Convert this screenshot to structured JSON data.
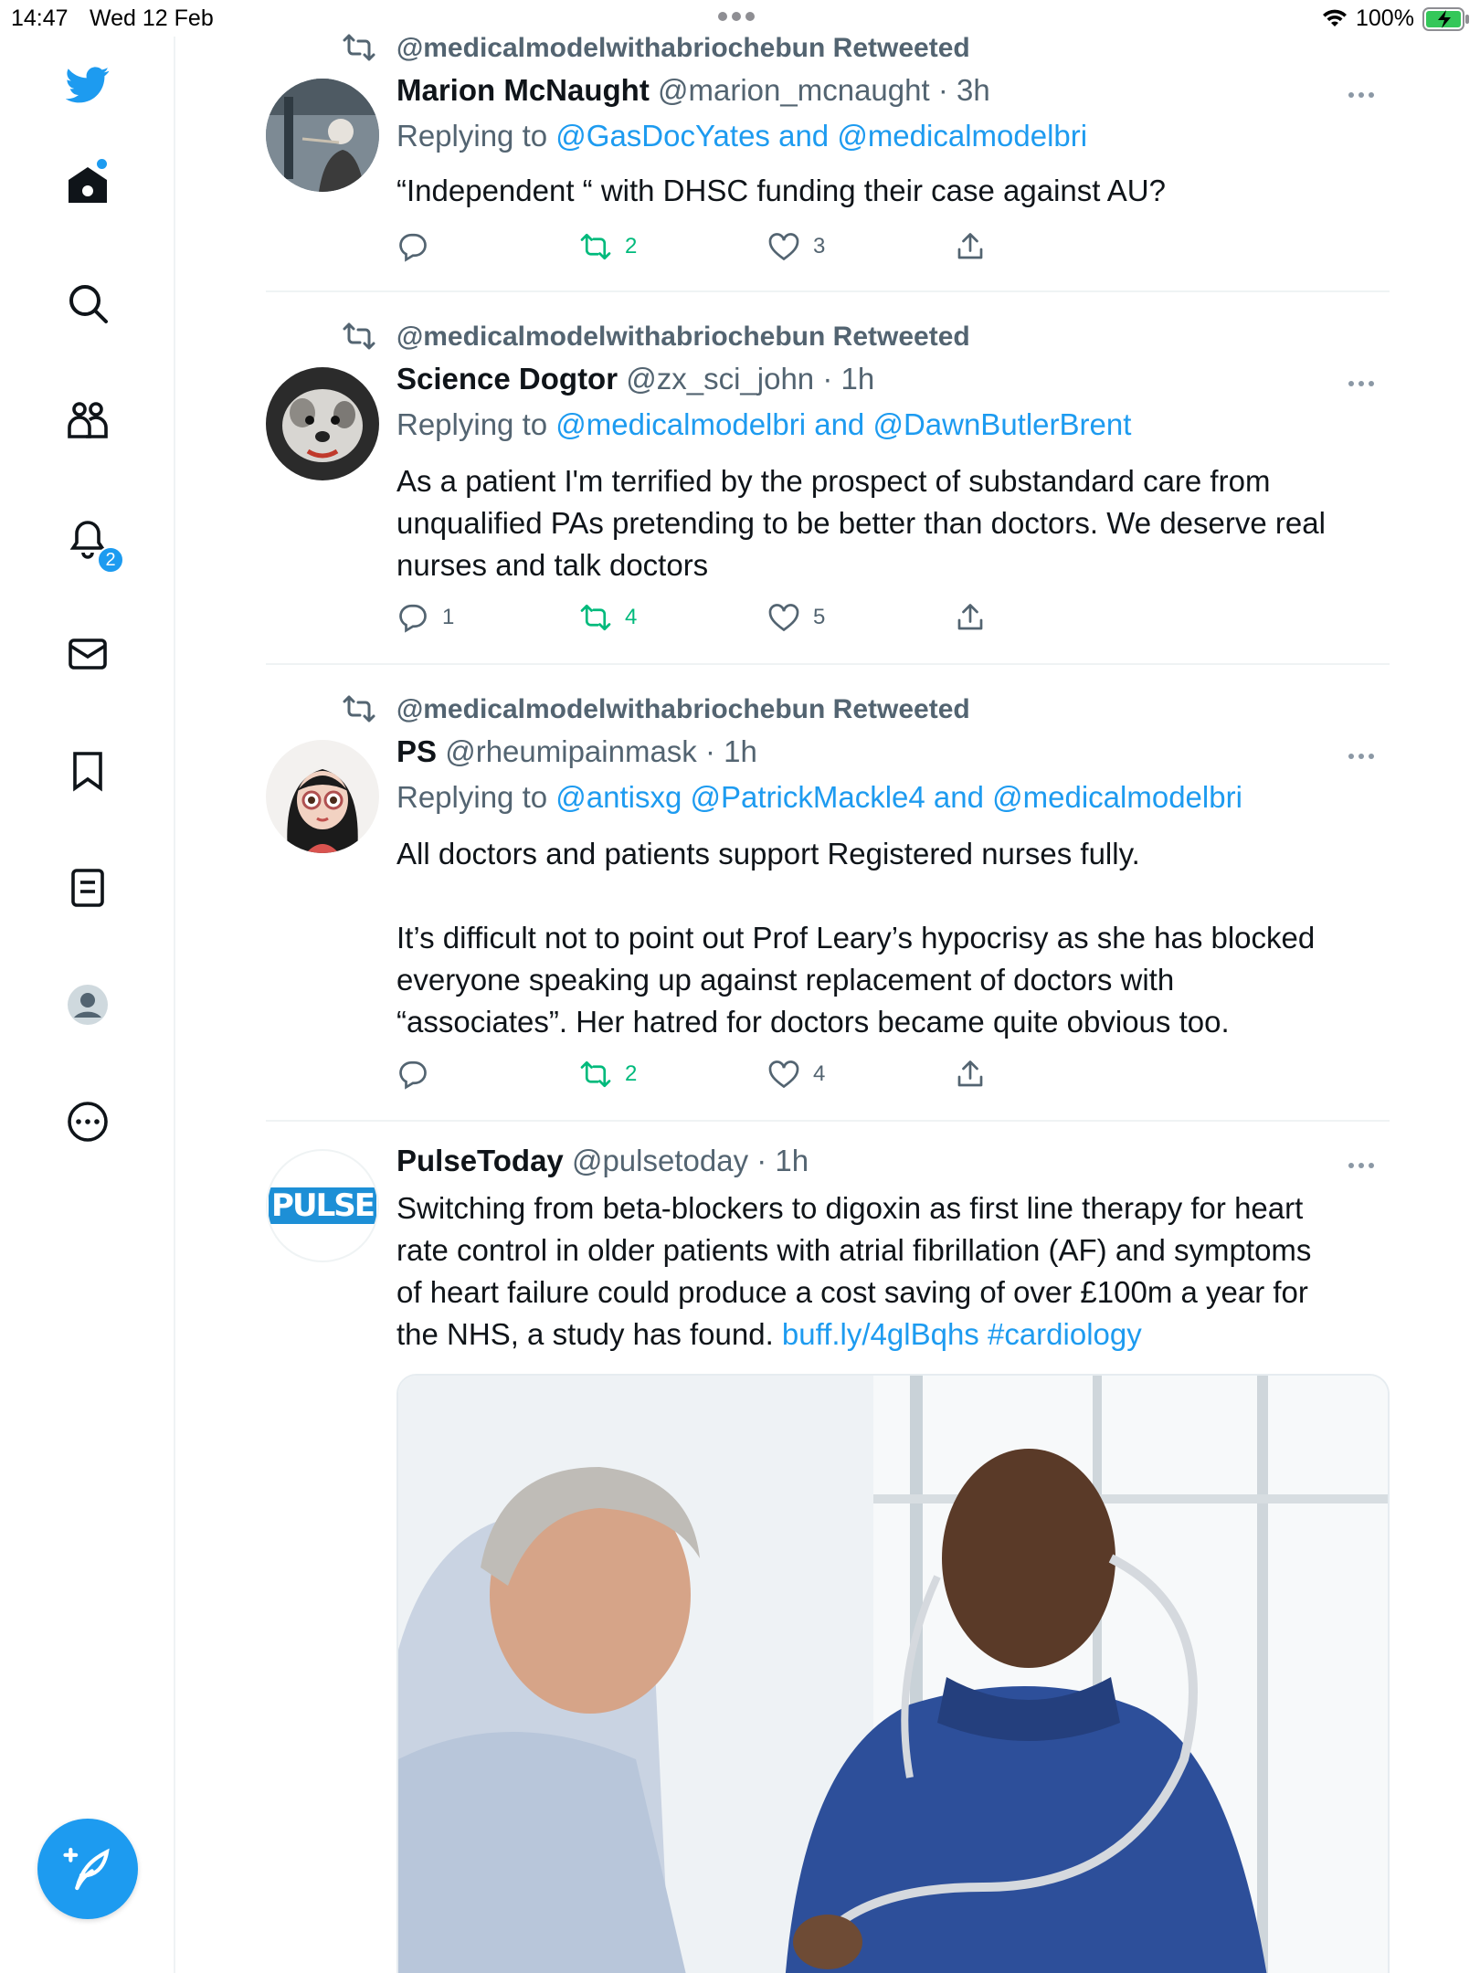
{
  "status_bar": {
    "time": "14:47",
    "date": "Wed 12 Feb",
    "battery": "100%"
  },
  "sidebar": {
    "items": [
      "twitter-logo",
      "home",
      "explore",
      "communities",
      "notifications",
      "messages",
      "bookmarks",
      "lists",
      "profile",
      "more"
    ],
    "notifications_badge": "2"
  },
  "colors": {
    "accent": "#1d9bf0",
    "retweet_green": "#00ba7c",
    "secondary_text": "#536471"
  },
  "tweets": [
    {
      "retweeted_by": "@medicalmodelwithabriochebun Retweeted",
      "name": "Marion McNaught",
      "handle": "@marion_mcnaught",
      "sep": "·",
      "time": "3h",
      "replying_prefix": "Replying to",
      "replying_to": "@GasDocYates and @medicalmodelbri",
      "text": "“Independent “ with DHSC funding their case against AU?",
      "replies": "",
      "retweets": "2",
      "likes": "3"
    },
    {
      "retweeted_by": "@medicalmodelwithabriochebun Retweeted",
      "name": "Science Dogtor",
      "handle": "@zx_sci_john",
      "sep": "·",
      "time": "1h",
      "replying_prefix": "Replying to",
      "replying_to": "@medicalmodelbri and @DawnButlerBrent",
      "text_lines": [
        "As a patient I'm terrified by the prospect of substandard care from",
        "unqualified PAs pretending to be better than doctors. We deserve real",
        "nurses and talk doctors"
      ],
      "replies": "1",
      "retweets": "4",
      "likes": "5"
    },
    {
      "retweeted_by": "@medicalmodelwithabriochebun Retweeted",
      "name": "PS",
      "handle": "@rheumipainmask",
      "sep": "·",
      "time": "1h",
      "replying_prefix": "Replying to",
      "replying_to": "@antisxg @PatrickMackle4 and @medicalmodelbri",
      "text_lines": [
        "All doctors and patients support Registered nurses fully.",
        "",
        "It’s difficult not to point out Prof Leary’s hypocrisy as she has blocked",
        "everyone speaking up against replacement of doctors with",
        "“associates”. Her hatred for doctors became quite obvious too."
      ],
      "replies": "",
      "retweets": "2",
      "likes": "4"
    },
    {
      "name": "PulseToday",
      "handle": "@pulsetoday",
      "sep": "·",
      "time": "1h",
      "avatar_text": "PULSE",
      "text_lines": [
        "Switching from beta-blockers to digoxin as first line therapy for heart",
        "rate control in older patients with atrial fibrillation (AF) and symptoms",
        "of heart failure could produce a cost saving of over £100m a year for",
        "the NHS, a study has found."
      ],
      "link": "buff.ly/4glBqhs",
      "hashtag": "#cardiology"
    }
  ]
}
